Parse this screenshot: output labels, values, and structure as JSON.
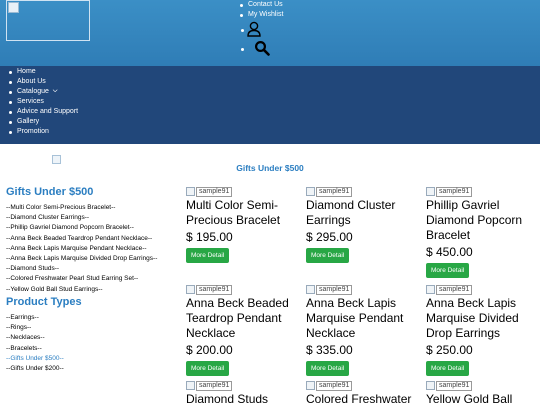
{
  "header": {
    "top_links": [
      "Contact Us",
      "My Wishlist"
    ]
  },
  "nav": {
    "items": [
      "Home",
      "About Us",
      "Catalogue",
      "Services",
      "Advice and Support",
      "Gallery",
      "Promotion"
    ]
  },
  "page": {
    "heading": "Gifts Under $500"
  },
  "sidebar": {
    "gifts_title": "Gifts Under $500",
    "gifts": [
      "--Multi Color Semi-Precious Bracelet--",
      "--Diamond Cluster Earrings--",
      "--Phillip Gavriel Diamond Popcorn Bracelet--",
      "--Anna Beck Beaded Teardrop Pendant Necklace--",
      "--Anna Beck Lapis Marquise Pendant Necklace--",
      "--Anna Beck Lapis Marquise Divided Drop Earrings--",
      "--Diamond Studs--",
      "--Colored Freshwater Pearl Stud Earring Set--",
      "--Yellow Gold Ball Stud Earrings--"
    ],
    "types_title": "Product Types",
    "types": [
      "--Earrings--",
      "--Rings--",
      "--Necklaces--",
      "--Bracelets--",
      "--Gifts Under $500--",
      "--Gifts Under $200--"
    ]
  },
  "products": [
    {
      "thumb": "sample91",
      "name": "Multi Color Semi-Precious Bracelet",
      "price": "$ 195.00",
      "button": "More Detail"
    },
    {
      "thumb": "sample91",
      "name": "Diamond Cluster Earrings",
      "price": "$ 295.00",
      "button": "More Detail"
    },
    {
      "thumb": "sample91",
      "name": "Phillip Gavriel Diamond Popcorn Bracelet",
      "price": "$ 450.00",
      "button": "More Detail"
    },
    {
      "thumb": "sample91",
      "name": "Anna Beck Beaded Teardrop Pendant Necklace",
      "price": "$ 200.00",
      "button": "More Detail"
    },
    {
      "thumb": "sample91",
      "name": "Anna Beck Lapis Marquise Pendant Necklace",
      "price": "$ 335.00",
      "button": "More Detail"
    },
    {
      "thumb": "sample91",
      "name": "Anna Beck Lapis Marquise Divided Drop Earrings",
      "price": "$ 250.00",
      "button": "More Detail"
    },
    {
      "thumb": "sample91",
      "name": "Diamond Studs",
      "price": "",
      "button": ""
    },
    {
      "thumb": "sample91",
      "name": "Colored Freshwater",
      "price": "",
      "button": ""
    },
    {
      "thumb": "sample91",
      "name": "Yellow Gold Ball",
      "price": "",
      "button": ""
    }
  ],
  "colors": {
    "header_blue": "#3b8fc6",
    "nav_navy": "#21477a",
    "accent_blue": "#2b7ec1",
    "button_green": "#28a745"
  },
  "icons": {
    "account": "user-icon",
    "search": "search-icon",
    "dropdown": "chevron-down-icon",
    "broken_image": "broken-image-icon"
  }
}
